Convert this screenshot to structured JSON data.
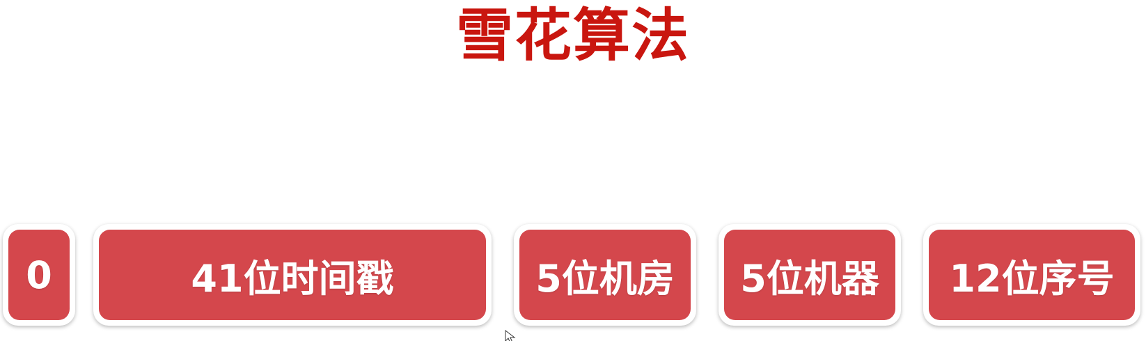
{
  "title": "雪花算法",
  "segments": [
    {
      "label": "0"
    },
    {
      "label": "41位时间戳"
    },
    {
      "label": "5位机房"
    },
    {
      "label": "5位机器"
    },
    {
      "label": "12位序号"
    }
  ],
  "colors": {
    "title": "#c9160f",
    "segment_fill": "#d4474c",
    "segment_text": "#ffffff"
  },
  "icons": {
    "cursor": "mouse-pointer-icon"
  }
}
